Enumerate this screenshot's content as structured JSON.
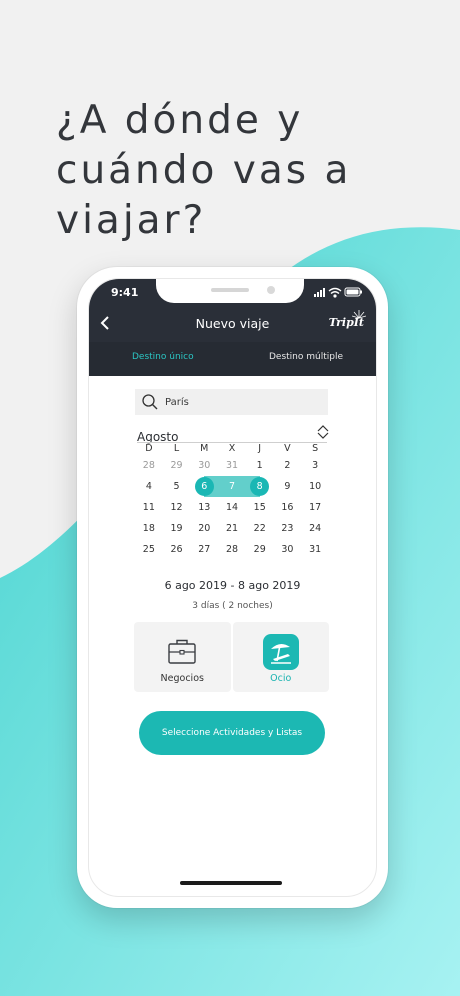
{
  "headline": [
    "¿A dónde y",
    "cuándo vas a",
    "viajar?"
  ],
  "status_bar": {
    "time": "9:41"
  },
  "nav": {
    "title": "Nuevo viaje",
    "brand": "TripIt"
  },
  "tabs": {
    "single": "Destino único",
    "multiple": "Destino múltiple"
  },
  "search": {
    "value": "París"
  },
  "calendar": {
    "month": "Agosto",
    "weekdays": [
      "D",
      "L",
      "M",
      "X",
      "J",
      "V",
      "S"
    ],
    "weeks": [
      [
        28,
        29,
        30,
        31,
        1,
        2,
        3
      ],
      [
        4,
        5,
        6,
        7,
        8,
        9,
        10
      ],
      [
        11,
        12,
        13,
        14,
        15,
        16,
        17
      ],
      [
        18,
        19,
        20,
        21,
        22,
        23,
        24
      ],
      [
        25,
        26,
        27,
        28,
        29,
        30,
        31
      ]
    ],
    "selected_start": 6,
    "selected_end": 8
  },
  "summary": {
    "range": "6 ago 2019 - 8 ago 2019",
    "nights": "3 días ( 2 noches)"
  },
  "trip_types": {
    "business": "Negocios",
    "leisure": "Ocio"
  },
  "cta": {
    "label": "Seleccione Actividades y Listas"
  },
  "colors": {
    "accent": "#1cb8b3",
    "range": "#62cfcb",
    "navbar": "#2a2f38"
  }
}
